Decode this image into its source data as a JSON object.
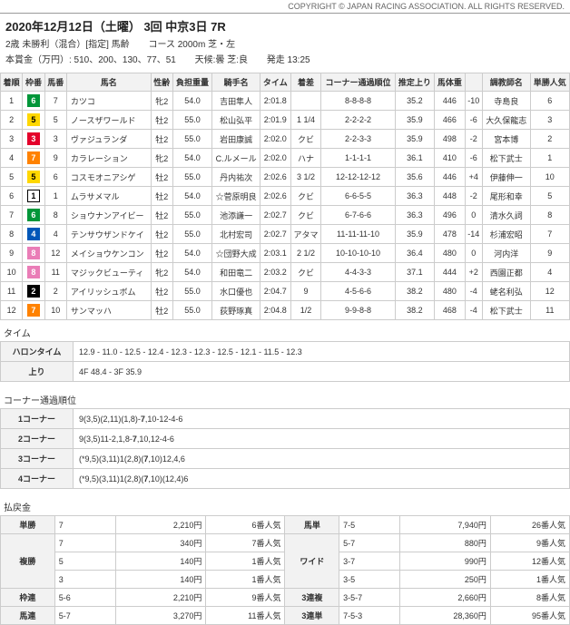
{
  "copyright": "COPYRIGHT © JAPAN RACING ASSOCIATION. ALL RIGHTS RESERVED.",
  "hdr": {
    "title": "2020年12月12日（土曜） 3回 中京3日 7R",
    "cond": "2歳 未勝利（混合）[指定] 馬齢",
    "course": "コース 2000m 芝・左",
    "prize": "本賞金（万円）: 510、200、130、77、51",
    "weather": "天候:曇 芝:良",
    "start": "発走 13:25"
  },
  "cols": [
    "着順",
    "枠番",
    "馬番",
    "馬名",
    "性齢",
    "負担重量",
    "騎手名",
    "タイム",
    "着差",
    "コーナー通過順位",
    "推定上り",
    "馬体重",
    "",
    "調教師名",
    "単勝人気"
  ],
  "rows": [
    {
      "pos": "1",
      "f": 6,
      "no": "7",
      "name": "カツコ",
      "sa": "牝2",
      "wt": "54.0",
      "jk": "吉田隼人",
      "tm": "2:01.8",
      "mg": "",
      "cn": "8-8-8-8",
      "ag": "35.2",
      "bw": "446",
      "bd": "-10",
      "tr": "寺島良",
      "pop": "6"
    },
    {
      "pos": "2",
      "f": 5,
      "no": "5",
      "name": "ノースザワールド",
      "sa": "牡2",
      "wt": "55.0",
      "jk": "松山弘平",
      "tm": "2:01.9",
      "mg": "1 1/4",
      "cn": "2-2-2-2",
      "ag": "35.9",
      "bw": "466",
      "bd": "-6",
      "tr": "大久保龍志",
      "pop": "3"
    },
    {
      "pos": "3",
      "f": 3,
      "no": "3",
      "name": "ヴァジュランダ",
      "sa": "牡2",
      "wt": "55.0",
      "jk": "岩田康誠",
      "tm": "2:02.0",
      "mg": "クビ",
      "cn": "2-2-3-3",
      "ag": "35.9",
      "bw": "498",
      "bd": "-2",
      "tr": "宮本博",
      "pop": "2"
    },
    {
      "pos": "4",
      "f": 7,
      "no": "9",
      "name": "カラレーション",
      "sa": "牝2",
      "wt": "54.0",
      "jk": "C.ルメール",
      "tm": "2:02.0",
      "mg": "ハナ",
      "cn": "1-1-1-1",
      "ag": "36.1",
      "bw": "410",
      "bd": "-6",
      "tr": "松下武士",
      "pop": "1"
    },
    {
      "pos": "5",
      "f": 5,
      "no": "6",
      "name": "コスモオニアシゲ",
      "sa": "牡2",
      "wt": "55.0",
      "jk": "丹内祐次",
      "tm": "2:02.6",
      "mg": "3 1/2",
      "cn": "12-12-12-12",
      "ag": "35.6",
      "bw": "446",
      "bd": "+4",
      "tr": "伊藤伸一",
      "pop": "10"
    },
    {
      "pos": "6",
      "f": 1,
      "no": "1",
      "name": "ムラサメマル",
      "sa": "牡2",
      "wt": "54.0",
      "jk": "☆菅原明良",
      "tm": "2:02.6",
      "mg": "クビ",
      "cn": "6-6-5-5",
      "ag": "36.3",
      "bw": "448",
      "bd": "-2",
      "tr": "尾形和幸",
      "pop": "5"
    },
    {
      "pos": "7",
      "f": 6,
      "no": "8",
      "name": "ショウナンアイビー",
      "sa": "牡2",
      "wt": "55.0",
      "jk": "池添謙一",
      "tm": "2:02.7",
      "mg": "クビ",
      "cn": "6-7-6-6",
      "ag": "36.3",
      "bw": "496",
      "bd": "0",
      "tr": "清水久詞",
      "pop": "8"
    },
    {
      "pos": "8",
      "f": 4,
      "no": "4",
      "name": "テンサウザンドケイ",
      "sa": "牡2",
      "wt": "55.0",
      "jk": "北村宏司",
      "tm": "2:02.7",
      "mg": "アタマ",
      "cn": "11-11-11-10",
      "ag": "35.9",
      "bw": "478",
      "bd": "-14",
      "tr": "杉浦宏昭",
      "pop": "7"
    },
    {
      "pos": "9",
      "f": 8,
      "no": "12",
      "name": "メイショウケンコン",
      "sa": "牡2",
      "wt": "54.0",
      "jk": "☆団野大成",
      "tm": "2:03.1",
      "mg": "2 1/2",
      "cn": "10-10-10-10",
      "ag": "36.4",
      "bw": "480",
      "bd": "0",
      "tr": "河内洋",
      "pop": "9"
    },
    {
      "pos": "10",
      "f": 8,
      "no": "11",
      "name": "マジックビューティ",
      "sa": "牝2",
      "wt": "54.0",
      "jk": "和田竜二",
      "tm": "2:03.2",
      "mg": "クビ",
      "cn": "4-4-3-3",
      "ag": "37.1",
      "bw": "444",
      "bd": "+2",
      "tr": "西園正都",
      "pop": "4"
    },
    {
      "pos": "11",
      "f": 2,
      "no": "2",
      "name": "アイリッシュボム",
      "sa": "牡2",
      "wt": "55.0",
      "jk": "水口優也",
      "tm": "2:04.7",
      "mg": "9",
      "cn": "4-5-6-6",
      "ag": "38.2",
      "bw": "480",
      "bd": "-4",
      "tr": "蛯名利弘",
      "pop": "12"
    },
    {
      "pos": "12",
      "f": 7,
      "no": "10",
      "name": "サンマッハ",
      "sa": "牡2",
      "wt": "55.0",
      "jk": "荻野琢真",
      "tm": "2:04.8",
      "mg": "1/2",
      "cn": "9-9-8-8",
      "ag": "38.2",
      "bw": "468",
      "bd": "-4",
      "tr": "松下武士",
      "pop": "11"
    }
  ],
  "time": {
    "title": "タイム",
    "halon_l": "ハロンタイム",
    "halon": "12.9 - 11.0 - 12.5 - 12.4 - 12.3 - 12.3 - 12.5 - 12.1 - 11.5 - 12.3",
    "agari_l": "上り",
    "agari": "4F 48.4 - 3F 35.9"
  },
  "corner": {
    "title": "コーナー通過順位",
    "rows": [
      {
        "l": "1コーナー",
        "v": "9(3,5)(2,11)(1,8)-<b>7</b>,10-12-4-6"
      },
      {
        "l": "2コーナー",
        "v": "9(3,5)11-2,1,8-<b>7</b>,10,12-4-6"
      },
      {
        "l": "3コーナー",
        "v": "(*9,5)(3,11)1(2,8)(<b>7</b>,10)12,4,6"
      },
      {
        "l": "4コーナー",
        "v": "(*9,5)(3,11)1(2,8)(<b>7</b>,10)(12,4)6"
      }
    ]
  },
  "pay": {
    "title": "払戻金",
    "left": [
      {
        "l": "単勝",
        "r": [
          [
            "7",
            "2,210円",
            "6番人気"
          ]
        ]
      },
      {
        "l": "複勝",
        "r": [
          [
            "7",
            "340円",
            "7番人気"
          ],
          [
            "5",
            "140円",
            "1番人気"
          ],
          [
            "3",
            "140円",
            "1番人気"
          ]
        ]
      },
      {
        "l": "枠連",
        "r": [
          [
            "5-6",
            "2,210円",
            "9番人気"
          ]
        ]
      },
      {
        "l": "馬連",
        "r": [
          [
            "5-7",
            "3,270円",
            "11番人気"
          ]
        ]
      }
    ],
    "right": [
      {
        "l": "馬単",
        "r": [
          [
            "7-5",
            "7,940円",
            "26番人気"
          ]
        ]
      },
      {
        "l": "ワイド",
        "r": [
          [
            "5-7",
            "880円",
            "9番人気"
          ],
          [
            "3-7",
            "990円",
            "12番人気"
          ],
          [
            "3-5",
            "250円",
            "1番人気"
          ]
        ]
      },
      {
        "l": "3連複",
        "r": [
          [
            "3-5-7",
            "2,660円",
            "8番人気"
          ]
        ]
      },
      {
        "l": "3連単",
        "r": [
          [
            "7-5-3",
            "28,360円",
            "95番人気"
          ]
        ]
      }
    ]
  }
}
